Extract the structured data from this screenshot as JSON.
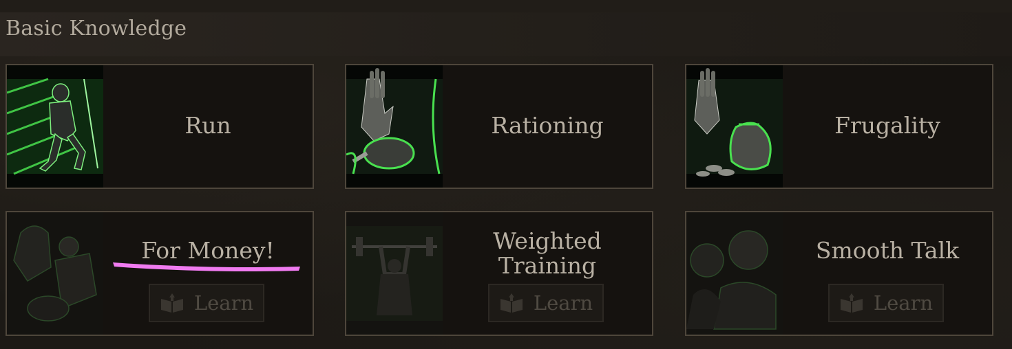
{
  "section": {
    "title": "Basic Knowledge"
  },
  "skills": [
    {
      "name": "Run",
      "learn_label": ""
    },
    {
      "name": "Rationing",
      "learn_label": ""
    },
    {
      "name": "Frugality",
      "learn_label": ""
    },
    {
      "name": "For Money!",
      "learn_label": "Learn"
    },
    {
      "name_line1": "Weighted",
      "name_line2": "Training",
      "learn_label": "Learn"
    },
    {
      "name": "Smooth Talk",
      "learn_label": "Learn"
    }
  ],
  "colors": {
    "accent_green": "#3fd84a",
    "annotation_pink": "#f07bf0",
    "card_border": "#4e463b"
  },
  "icons": [
    "run-icon",
    "rationing-icon",
    "frugality-icon",
    "for-money-icon",
    "weighted-training-icon",
    "smooth-talk-icon",
    "book-icon"
  ]
}
